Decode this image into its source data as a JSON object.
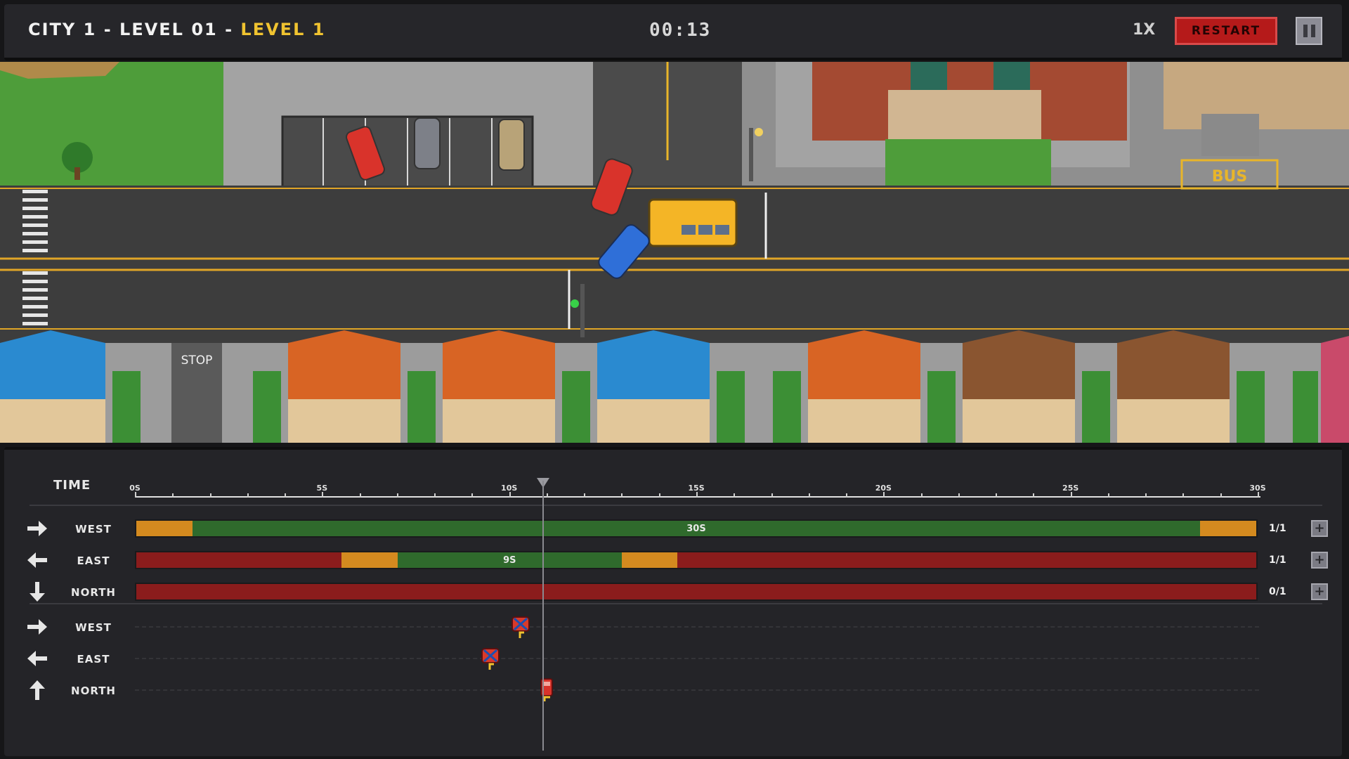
{
  "header": {
    "title_prefix": "CITY 1 - LEVEL 01 - ",
    "title_level": "LEVEL 1",
    "timer": "00:13",
    "speed": "1X",
    "restart_label": "RESTART"
  },
  "map": {
    "stop_sign_text": "STOP",
    "bus_stop_text": "BUS"
  },
  "timeline": {
    "time_label": "TIME",
    "ticks": [
      "0S",
      "5S",
      "10S",
      "15S",
      "20S",
      "25S",
      "30S"
    ],
    "current_time_s": 10.9,
    "total_s": 30
  },
  "signals": [
    {
      "direction": "WEST",
      "arrow": "arrow-right-icon",
      "count": "1/1",
      "segments": [
        {
          "state": "yellow",
          "start": 0,
          "end": 1.5
        },
        {
          "state": "green",
          "start": 1.5,
          "end": 28.5,
          "label": "30S"
        },
        {
          "state": "yellow",
          "start": 28.5,
          "end": 30
        }
      ]
    },
    {
      "direction": "EAST",
      "arrow": "arrow-left-icon",
      "count": "1/1",
      "segments": [
        {
          "state": "red",
          "start": 0,
          "end": 5.5
        },
        {
          "state": "yellow",
          "start": 5.5,
          "end": 7
        },
        {
          "state": "green",
          "start": 7,
          "end": 13,
          "label": "9S"
        },
        {
          "state": "yellow",
          "start": 13,
          "end": 14.5
        },
        {
          "state": "red",
          "start": 14.5,
          "end": 30
        }
      ]
    },
    {
      "direction": "NORTH",
      "arrow": "arrow-down-icon",
      "count": "0/1",
      "segments": [
        {
          "state": "red",
          "start": 0,
          "end": 30
        }
      ]
    }
  ],
  "traffic": [
    {
      "direction": "WEST",
      "arrow": "arrow-right-icon",
      "events": [
        {
          "time_s": 10.3,
          "type": "crash"
        }
      ]
    },
    {
      "direction": "EAST",
      "arrow": "arrow-left-icon",
      "events": [
        {
          "time_s": 9.5,
          "type": "crash"
        }
      ]
    },
    {
      "direction": "NORTH",
      "arrow": "arrow-up-icon",
      "events": [
        {
          "time_s": 11.0,
          "type": "car"
        }
      ]
    }
  ],
  "colors": {
    "red": "#8b1c1c",
    "green": "#2f6a2c",
    "yellow": "#d48a1f",
    "accent": "#f0c330",
    "restart": "#b51a1a"
  }
}
